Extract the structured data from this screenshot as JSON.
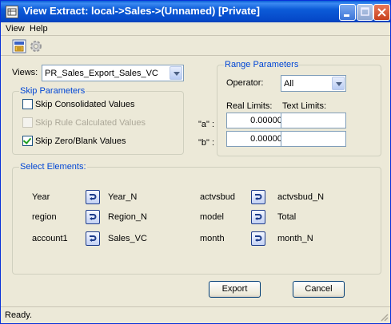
{
  "window": {
    "title": "View Extract:  local->Sales->(Unnamed)  [Private]"
  },
  "menu": {
    "items": [
      "View",
      "Help"
    ]
  },
  "views": {
    "label": "Views:",
    "selected": "PR_Sales_Export_Sales_VC"
  },
  "skip": {
    "title": "Skip Parameters",
    "consolidated": {
      "label": "Skip Consolidated Values",
      "checked": false,
      "enabled": true
    },
    "rule_calculated": {
      "label": "Skip Rule Calculated Values",
      "checked": false,
      "enabled": false
    },
    "zero_blank": {
      "label": "Skip Zero/Blank Values",
      "checked": true,
      "enabled": true
    }
  },
  "range": {
    "title": "Range Parameters",
    "operator_label": "Operator:",
    "operator_value": "All",
    "real_limits_label": "Real Limits:",
    "text_limits_label": "Text Limits:",
    "a_label": "\"a\" :",
    "b_label": "\"b\" :",
    "a_real": "0.000000",
    "b_real": "0.000000",
    "a_text": "",
    "b_text": ""
  },
  "elements": {
    "title": "Select Elements:",
    "left": [
      {
        "dim": "Year",
        "subset": "Year_N"
      },
      {
        "dim": "region",
        "subset": "Region_N"
      },
      {
        "dim": "account1",
        "subset": "Sales_VC"
      }
    ],
    "right": [
      {
        "dim": "actvsbud",
        "subset": "actvsbud_N"
      },
      {
        "dim": "model",
        "subset": "Total"
      },
      {
        "dim": "month",
        "subset": "month_N"
      }
    ]
  },
  "buttons": {
    "export": "Export",
    "cancel": "Cancel"
  },
  "status": "Ready.",
  "colors": {
    "titlebar": "#0548c8",
    "group_label": "#0046d5",
    "dialog_bg": "#ece9d8"
  },
  "icons": {
    "toolbar": [
      "save-view-icon",
      "settings-icon"
    ],
    "element": "subset-editor-icon"
  }
}
